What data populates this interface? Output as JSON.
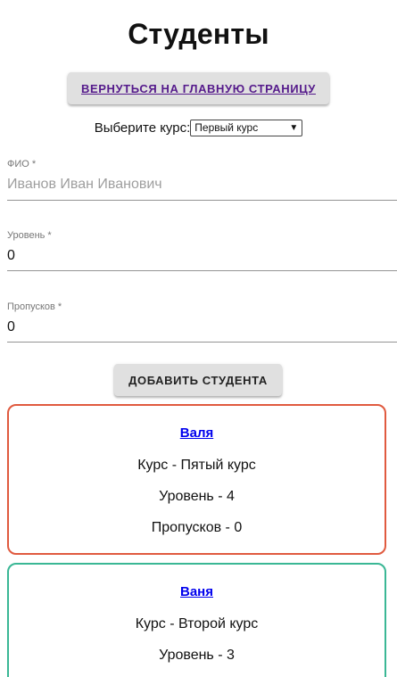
{
  "page": {
    "title": "Студенты"
  },
  "nav": {
    "home_label": "ВЕРНУТЬСЯ НА ГЛАВНУЮ СТРАНИЦУ"
  },
  "course_select": {
    "label": "Выберите курс:",
    "selected": "Первый курс"
  },
  "form": {
    "fio": {
      "label": "ФИО *",
      "placeholder": "Иванов Иван Иванович"
    },
    "level": {
      "label": "Уровень *",
      "value": "0"
    },
    "absences": {
      "label": "Пропусков *",
      "value": "0"
    },
    "add_label": "ДОБАВИТЬ СТУДЕНТА"
  },
  "students": [
    {
      "name": "Валя",
      "course": "Курс - Пятый курс",
      "level": "Уровень - 4",
      "absences": "Пропусков - 0",
      "border_color": "#e05a3f"
    },
    {
      "name": "Ваня",
      "course": "Курс - Второй курс",
      "level": "Уровень - 3",
      "absences": "",
      "border_color": "#3ab795"
    }
  ]
}
